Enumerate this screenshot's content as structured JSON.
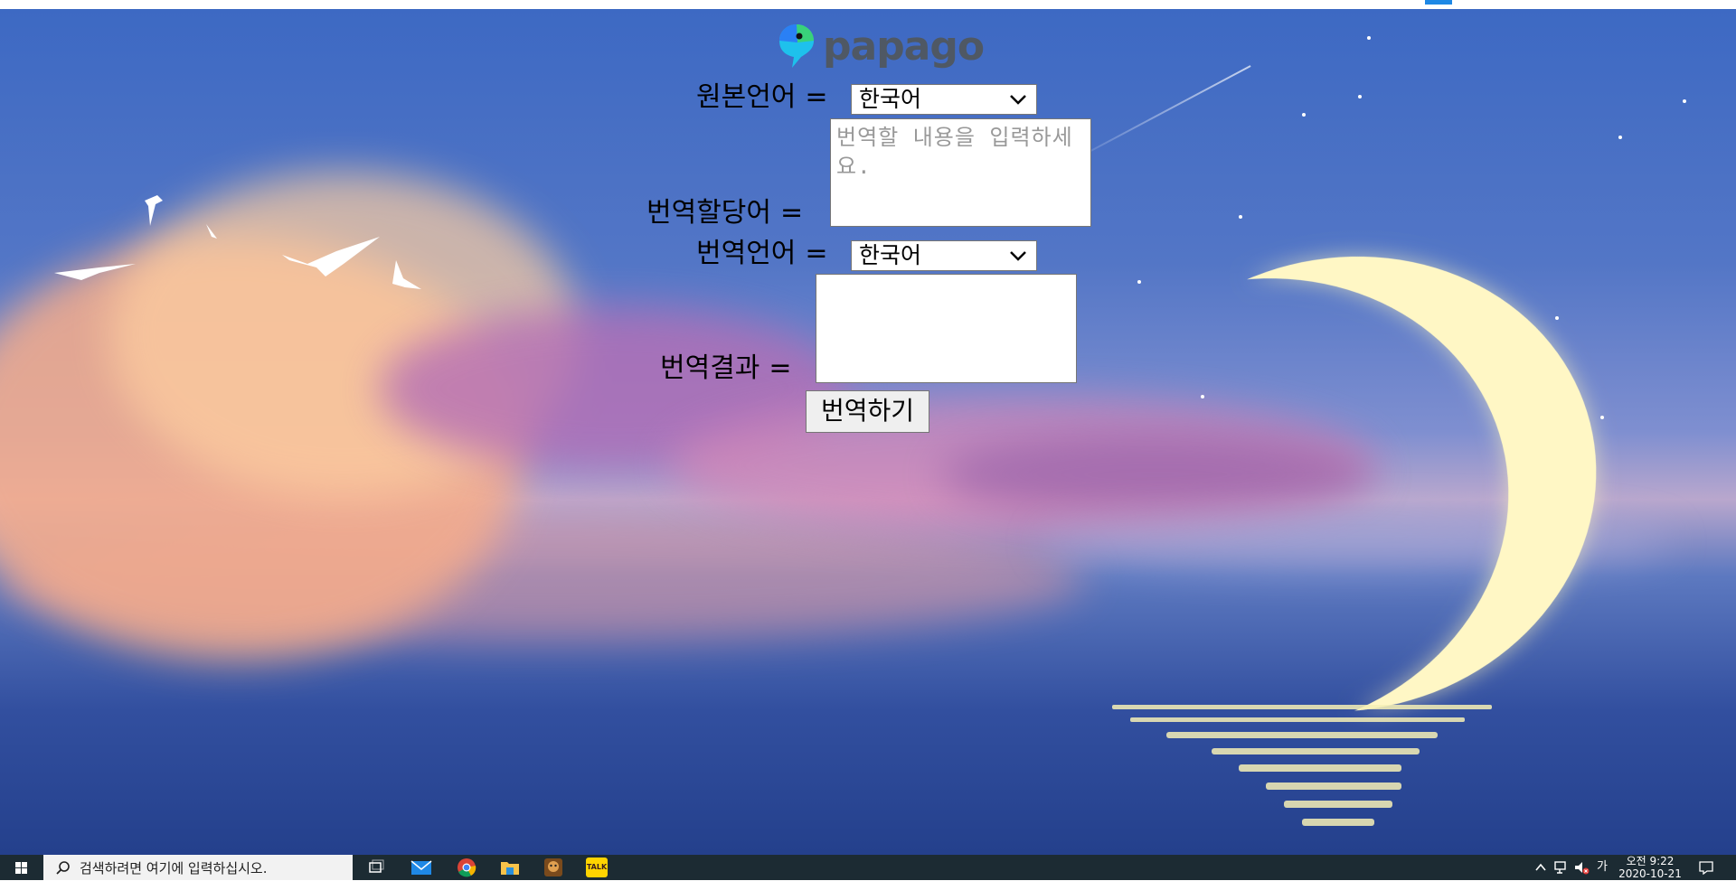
{
  "app": {
    "logo_text": "papago"
  },
  "form": {
    "source_lang_label": "원본언어",
    "source_text_label": "번역할당어",
    "target_lang_label": "번역언어",
    "result_label": "번역결과",
    "equals": "=",
    "source_lang_value": "한국어",
    "target_lang_value": "한국어",
    "source_text_placeholder": "번역할 내용을 입력하세요.",
    "result_text_value": "",
    "translate_button_label": "번역하기"
  },
  "taskbar": {
    "search_placeholder": "검색하려면 여기에 입력하십시오.",
    "ime_indicator": "가",
    "clock_time": "오전 9:22",
    "clock_date": "2020-10-21",
    "kakao_badge": "TALK"
  },
  "colors": {
    "sky_top": "#3d69c3",
    "moon": "#fff7c5",
    "taskbar": "#1c2b33",
    "logo_text": "#4f5864"
  },
  "icons": [
    "papago-parrot-icon",
    "windows-start-icon",
    "search-icon",
    "task-view-icon",
    "mail-icon",
    "chrome-icon",
    "file-explorer-icon",
    "game-app-icon",
    "kakaotalk-icon",
    "tray-chevron-icon",
    "network-icon",
    "volume-muted-icon",
    "notification-icon"
  ]
}
